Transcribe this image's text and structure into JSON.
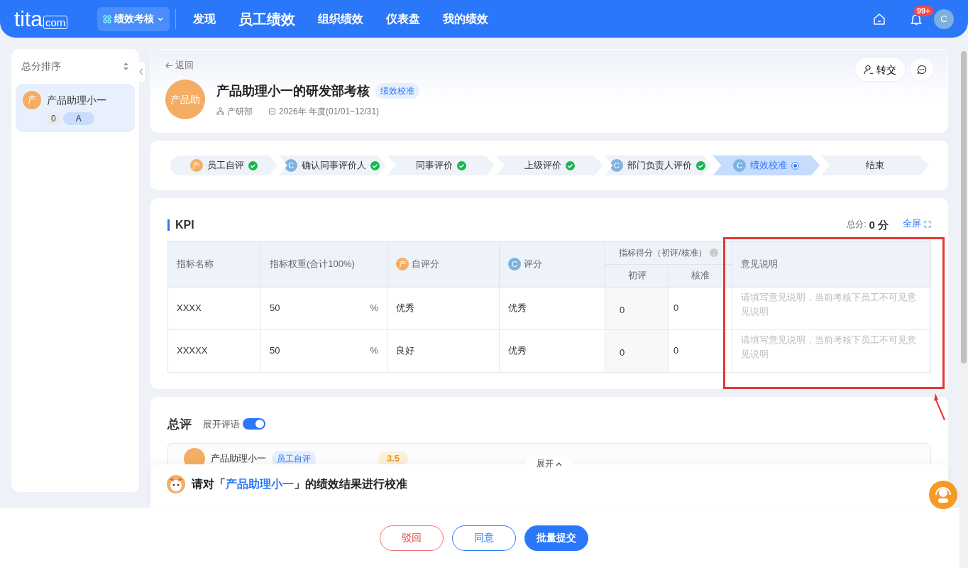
{
  "header": {
    "logo": "tita",
    "logo_suffix": "com",
    "module": "绩效考核",
    "nav": [
      {
        "label": "发现",
        "selected": false
      },
      {
        "label": "员工绩效",
        "selected": true
      },
      {
        "label": "组织绩效",
        "selected": false
      },
      {
        "label": "仪表盘",
        "selected": false
      },
      {
        "label": "我的绩效",
        "selected": false
      }
    ],
    "notification_badge": "99+",
    "avatar": "C"
  },
  "sidebar": {
    "title": "总分排序",
    "items": [
      {
        "avatar": "产",
        "name": "产品助理小一",
        "score": "0",
        "grade": "A",
        "selected": true
      }
    ]
  },
  "detail": {
    "back": "返回",
    "transfer": "转交",
    "avatar": "产品助",
    "title": "产品助理小一的研发部考核",
    "tag": "绩效校准",
    "department": "产研部",
    "period": "2026年 年度(01/01~12/31)"
  },
  "steps": [
    {
      "label": "员工自评",
      "avatar": "产",
      "kind": "self",
      "done": true,
      "selected": false
    },
    {
      "label": "确认同事评价人",
      "avatar": "C",
      "kind": "manager",
      "done": true,
      "selected": false
    },
    {
      "label": "同事评价",
      "done": true,
      "selected": false
    },
    {
      "label": "上级评价",
      "done": true,
      "selected": false
    },
    {
      "label": "部门负责人评价",
      "avatar": "C",
      "kind": "manager",
      "done": true,
      "selected": false
    },
    {
      "label": "绩效校准",
      "avatar": "C",
      "kind": "manager",
      "done": false,
      "selected": true
    },
    {
      "label": "结束",
      "done": false,
      "selected": false
    }
  ],
  "kpi": {
    "title": "KPI",
    "total_label": "总分:",
    "total": "0 分",
    "fullscreen": "全屏",
    "columns": [
      {
        "label": "指标名称"
      },
      {
        "label": "指标权重(合计100%)"
      },
      {
        "label": "自评分",
        "avatar": "产",
        "kind": "self"
      },
      {
        "label": "评分",
        "avatar": "C",
        "kind": "manager"
      },
      {
        "label": "意见说明"
      }
    ],
    "score_group": "指标得分（初评/核准）",
    "sub_columns": [
      "初评",
      "核准"
    ],
    "rows": [
      {
        "name": "XXXX",
        "weight": "50",
        "unit": "%",
        "self": "优秀",
        "rating": "优秀",
        "initial": "0",
        "approved": "0",
        "placeholder": "请填写意见说明，当前考核下员工不可见意见说明"
      },
      {
        "name": "XXXXX",
        "weight": "50",
        "unit": "%",
        "self": "良好",
        "rating": "优秀",
        "initial": "0",
        "approved": "0",
        "placeholder": "请填写意见说明，当前考核下员工不可见意见说明"
      }
    ]
  },
  "summary": {
    "title": "总评",
    "toggle_label": "展开评语",
    "toggle_on": true,
    "reviews": [
      {
        "name": "产品助理小一",
        "tag": "员工自评",
        "score": "3.5"
      }
    ]
  },
  "prompt": {
    "expand": "展开",
    "before": "请对「",
    "name": "产品助理小一",
    "after": "」的绩效结果进行校准"
  },
  "buttons": [
    {
      "label": "驳回",
      "kind": "danger"
    },
    {
      "label": "同意",
      "kind": "outline"
    },
    {
      "label": "批量提交",
      "kind": "primary"
    }
  ]
}
